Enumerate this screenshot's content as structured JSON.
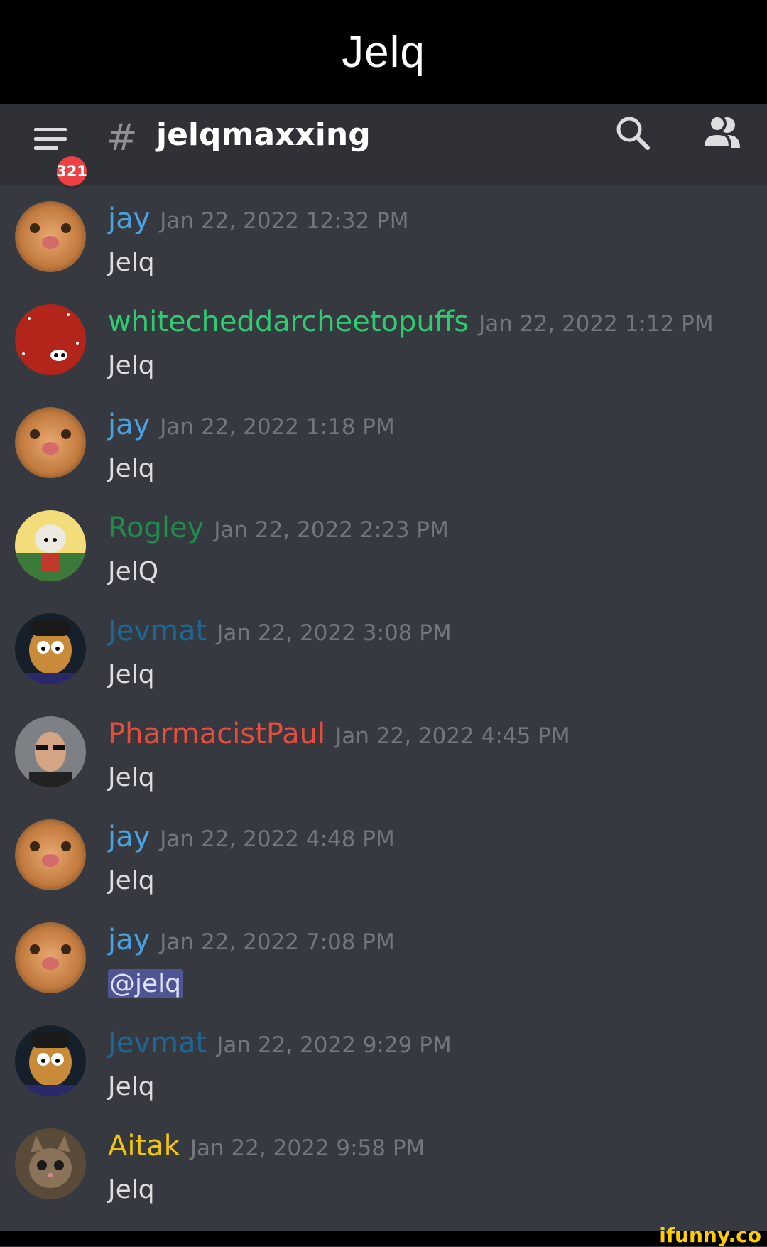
{
  "caption": "Jelq",
  "header": {
    "notification_count": "321",
    "channel_name": "jelqmaxxing",
    "hash_symbol": "#"
  },
  "colors": {
    "jay": "#4aa3e0",
    "whitecheddarcheetopuffs": "#2ecc71",
    "rogley": "#1f8b4c",
    "jevmat": "#206694",
    "pharmacistpaul": "#e74c3c",
    "aitak": "#f1c40f"
  },
  "messages": [
    {
      "user": "jay",
      "time": "Jan 22, 2022 12:32 PM",
      "text": "Jelq"
    },
    {
      "user": "whitecheddarcheetopuffs",
      "time": "Jan 22, 2022 1:12 PM",
      "text": "Jelq"
    },
    {
      "user": "jay",
      "time": "Jan 22, 2022 1:18 PM",
      "text": "Jelq"
    },
    {
      "user": "Rogley",
      "time": "Jan 22, 2022 2:23 PM",
      "text": "JelQ"
    },
    {
      "user": "Jevmat",
      "time": "Jan 22, 2022 3:08 PM",
      "text": "Jelq"
    },
    {
      "user": "PharmacistPaul",
      "time": "Jan 22, 2022 4:45 PM",
      "text": "Jelq"
    },
    {
      "user": "jay",
      "time": "Jan 22, 2022 4:48 PM",
      "text": "Jelq"
    },
    {
      "user": "jay",
      "time": "Jan 22, 2022 7:08 PM",
      "text": "@jelq"
    },
    {
      "user": "Jevmat",
      "time": "Jan 22, 2022 9:29 PM",
      "text": "Jelq"
    },
    {
      "user": "Aitak",
      "time": "Jan 22, 2022 9:58 PM",
      "text": "Jelq"
    }
  ],
  "watermark": "ifunny.co"
}
